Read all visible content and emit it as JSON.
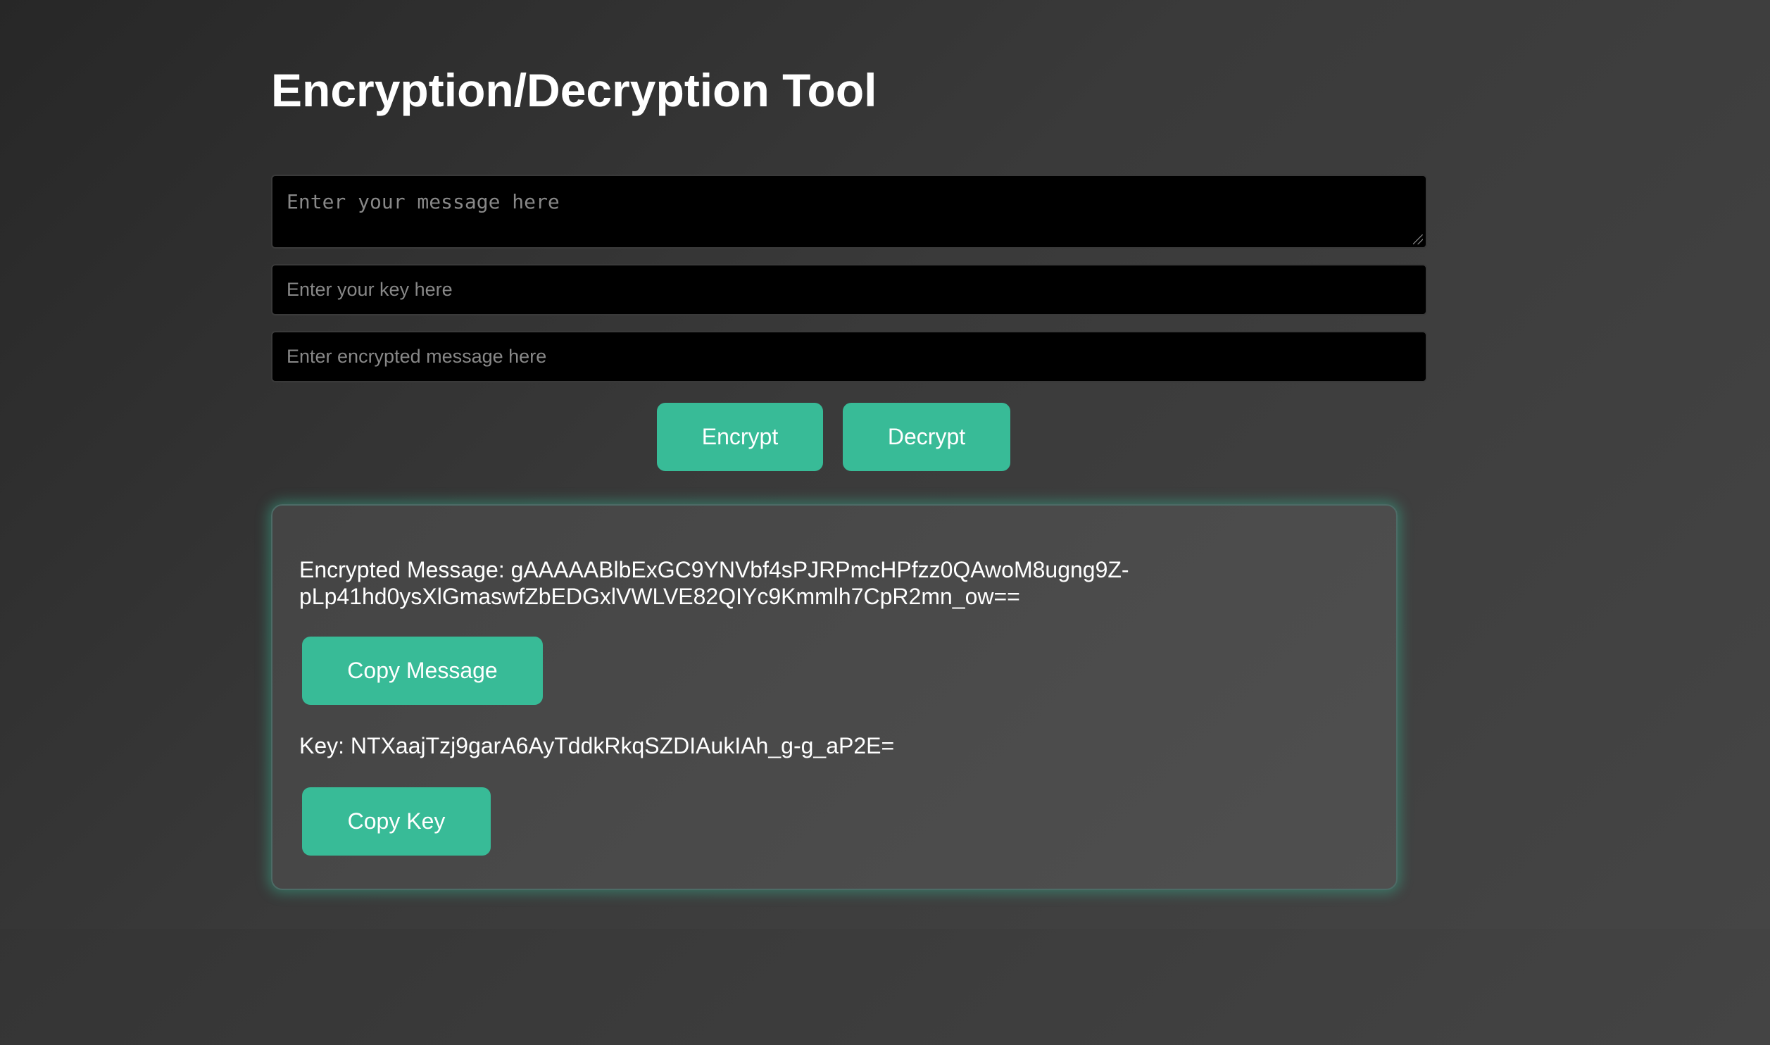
{
  "header": {
    "title": "Encryption/Decryption Tool"
  },
  "form": {
    "message_placeholder": "Enter your message here",
    "key_placeholder": "Enter your key here",
    "encrypted_placeholder": "Enter encrypted message here",
    "encrypt_label": "Encrypt",
    "decrypt_label": "Decrypt"
  },
  "result": {
    "encrypted_line1": "Encrypted Message: gAAAAABlbExGC9YNVbf4sPJRPmcHPfzz0QAwoM8ugng9Z-",
    "encrypted_line2": "pLp41hd0ysXlGmaswfZbEDGxlVWLVE82QIYc9Kmmlh7CpR2mn_ow==",
    "copy_message_label": "Copy Message",
    "key_text": "Key: NTXaajTzj9garA6AyTddkRkqSZDIAukIAh_g-g_aP2E=",
    "copy_key_label": "Copy Key"
  },
  "colors": {
    "accent": "#38bb97",
    "background": "#333333",
    "input_background": "#000000",
    "panel_glow": "#38bb97"
  }
}
